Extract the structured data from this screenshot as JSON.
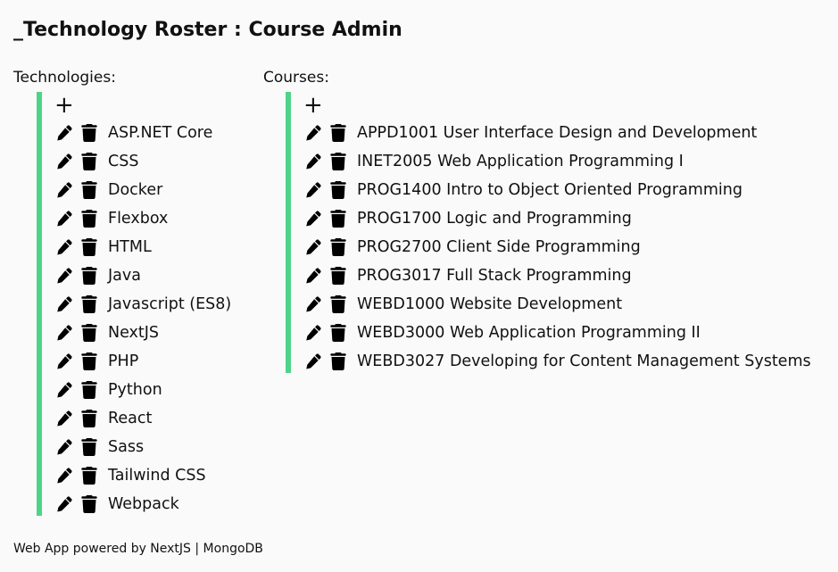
{
  "header": {
    "title": "_Technology Roster : Course Admin"
  },
  "technologies": {
    "label": "Technologies:",
    "add_symbol": "+",
    "items": [
      {
        "label": "ASP.NET Core"
      },
      {
        "label": "CSS"
      },
      {
        "label": "Docker"
      },
      {
        "label": "Flexbox"
      },
      {
        "label": "HTML"
      },
      {
        "label": "Java"
      },
      {
        "label": "Javascript (ES8)"
      },
      {
        "label": "NextJS"
      },
      {
        "label": "PHP"
      },
      {
        "label": "Python"
      },
      {
        "label": "React"
      },
      {
        "label": "Sass"
      },
      {
        "label": "Tailwind CSS"
      },
      {
        "label": "Webpack"
      }
    ]
  },
  "courses": {
    "label": "Courses:",
    "add_symbol": "+",
    "items": [
      {
        "label": "APPD1001 User Interface Design and Development"
      },
      {
        "label": "INET2005 Web Application Programming I"
      },
      {
        "label": "PROG1400 Intro to Object Oriented Programming"
      },
      {
        "label": "PROG1700 Logic and Programming"
      },
      {
        "label": "PROG2700 Client Side Programming"
      },
      {
        "label": "PROG3017 Full Stack Programming"
      },
      {
        "label": "WEBD1000 Website Development"
      },
      {
        "label": "WEBD3000 Web Application Programming II"
      },
      {
        "label": "WEBD3027 Developing for Content Management Systems"
      }
    ]
  },
  "footer": {
    "text": "Web App powered by NextJS | MongoDB"
  },
  "theme": {
    "accent": "#4fd389",
    "background": "#fafafa",
    "text": "#111111"
  },
  "icons": {
    "edit": "pencil-icon",
    "delete": "trash-icon",
    "add": "plus-icon"
  }
}
